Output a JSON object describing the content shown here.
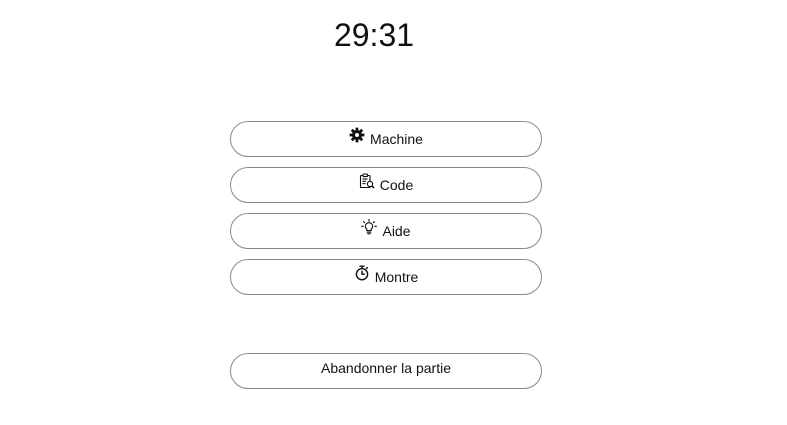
{
  "timer": {
    "value": "29:31"
  },
  "menu": {
    "items": [
      {
        "label": "Machine",
        "icon": "gear-icon"
      },
      {
        "label": "Code",
        "icon": "clipboard-search-icon"
      },
      {
        "label": "Aide",
        "icon": "lightbulb-icon"
      },
      {
        "label": "Montre",
        "icon": "stopwatch-icon"
      }
    ],
    "quit_label": "Abandonner la partie"
  },
  "colors": {
    "border": "#8a8a8a",
    "text": "#111111",
    "background": "#ffffff"
  }
}
